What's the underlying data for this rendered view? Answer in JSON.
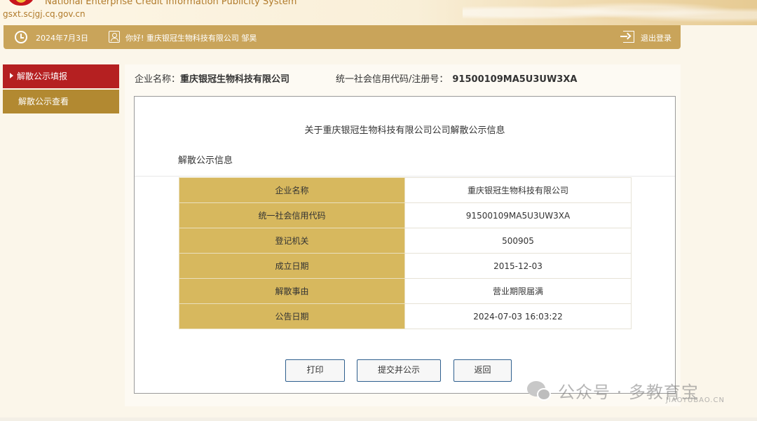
{
  "header": {
    "system_name_en": "National Enterprise Credit Information Publicity System",
    "domain": "gsxt.scjgj.cq.gov.cn"
  },
  "topbar": {
    "date": "2024年7月3日",
    "greeting": "你好! 重庆银冠生物科技有限公司 邹昊",
    "logout_label": "退出登录"
  },
  "sidebar": {
    "items": [
      {
        "label": "解散公示填报",
        "active": true
      },
      {
        "label": "解散公示查看",
        "active": false
      }
    ]
  },
  "main": {
    "company_label": "企业名称：",
    "company_name": "重庆银冠生物科技有限公司",
    "code_label": "统一社会信用代码/注册号：",
    "code_value": "91500109MA5U3UW3XA",
    "notice_title": "关于重庆银冠生物科技有限公司公司解散公示信息",
    "section_title": "解散公示信息",
    "table": [
      {
        "key": "企业名称",
        "value": "重庆银冠生物科技有限公司"
      },
      {
        "key": "统一社会信用代码",
        "value": "91500109MA5U3UW3XA"
      },
      {
        "key": "登记机关",
        "value": "500905"
      },
      {
        "key": "成立日期",
        "value": "2015-12-03"
      },
      {
        "key": "解散事由",
        "value": "营业期限届满"
      },
      {
        "key": "公告日期",
        "value": "2024-07-03 16:03:22"
      }
    ],
    "buttons": {
      "print": "打印",
      "submit": "提交并公示",
      "back": "返回"
    }
  },
  "watermark": {
    "text": "公众号 · 多教育宝",
    "sub": "JIAOYUBAO.CN"
  },
  "colors": {
    "topbar": "#c9a45a",
    "sidebar_active": "#b52021",
    "sidebar_normal": "#b28931",
    "table_key_bg": "#d7b85e",
    "button_border": "#2e5f8e"
  }
}
